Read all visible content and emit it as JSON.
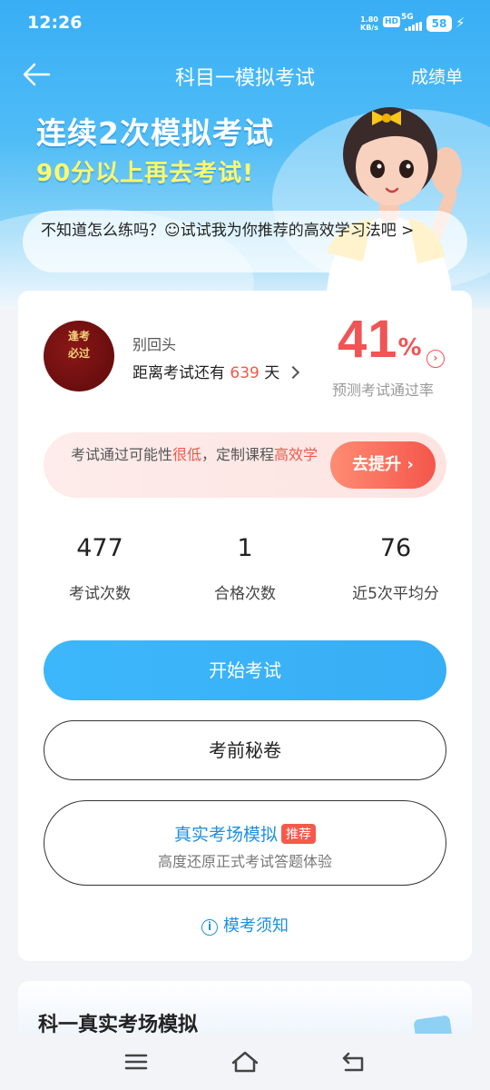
{
  "status_bar": {
    "time": "12:26",
    "net_speed": "1.80",
    "net_unit": "KB/s",
    "hd": "HD",
    "network": "5G",
    "battery": "58"
  },
  "nav": {
    "title": "科目一模拟考试",
    "right_link": "成绩单"
  },
  "hero": {
    "slogan_line1": "连续2次模拟考试",
    "slogan_line2": "90分以上再去考试!",
    "tip": "不知道怎么练吗？☺试试我为你推荐的高效学习法吧 >"
  },
  "profile": {
    "seal_text_top": "逢考",
    "seal_text_bottom": "必过",
    "nickname": "别回头",
    "countdown_prefix": "距离考试还有",
    "countdown_days": "639",
    "countdown_suffix": "天"
  },
  "pass_rate": {
    "value": "41",
    "unit": "%",
    "label": "预测考试通过率"
  },
  "advice": {
    "part1": "考试通过可能性",
    "part2": "很低",
    "part3": "，定制课程",
    "part4": "高效学",
    "button": "去提升"
  },
  "stats": [
    {
      "value": "477",
      "label": "考试次数"
    },
    {
      "value": "1",
      "label": "合格次数"
    },
    {
      "value": "76",
      "label": "近5次平均分"
    }
  ],
  "buttons": {
    "start": "开始考试",
    "secret": "考前秘卷",
    "real_title": "真实考场模拟",
    "real_tag": "推荐",
    "real_sub": "高度还原正式考试答题体验",
    "notice": "模考须知"
  },
  "section2": {
    "title": "科一真实考场模拟"
  },
  "colors": {
    "primary_blue": "#38aef5",
    "accent_red": "#f05454",
    "link_blue": "#1f90de"
  }
}
